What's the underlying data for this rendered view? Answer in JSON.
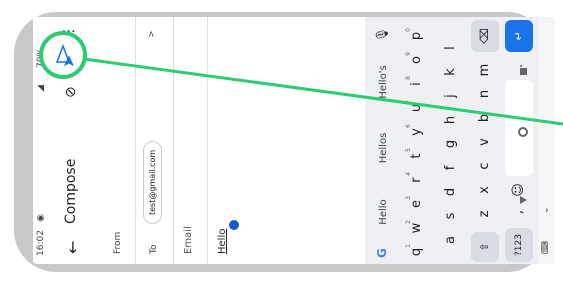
{
  "status_bar": {
    "time": "16:02",
    "battery": "70%"
  },
  "app_bar": {
    "title": "Compose",
    "back_label": "←"
  },
  "from": {
    "label": "From"
  },
  "to": {
    "label": "To",
    "recipient": "test@gmail.com",
    "expand_label": ">"
  },
  "subject": {
    "placeholder": "Email"
  },
  "body": {
    "text": "Hello"
  },
  "keyboard": {
    "suggestions": [
      "Hello",
      "Hellos",
      "Hello's"
    ],
    "row1": [
      "q",
      "w",
      "e",
      "r",
      "t",
      "y",
      "u",
      "i",
      "o",
      "p"
    ],
    "row1_numbers": [
      "1",
      "2",
      "3",
      "4",
      "5",
      "6",
      "7",
      "8",
      "9",
      "0"
    ],
    "row2": [
      "a",
      "s",
      "d",
      "f",
      "g",
      "h",
      "j",
      "k",
      "l"
    ],
    "row3": [
      "z",
      "x",
      "c",
      "v",
      "b",
      "n",
      "m"
    ],
    "row4": {
      "symbols": "?123",
      "comma": ",",
      "emoji": "☺",
      "period": "."
    }
  },
  "colors": {
    "accent": "#1a73e8",
    "callout": "#2ecc71",
    "frame": "#c8c8c8"
  }
}
